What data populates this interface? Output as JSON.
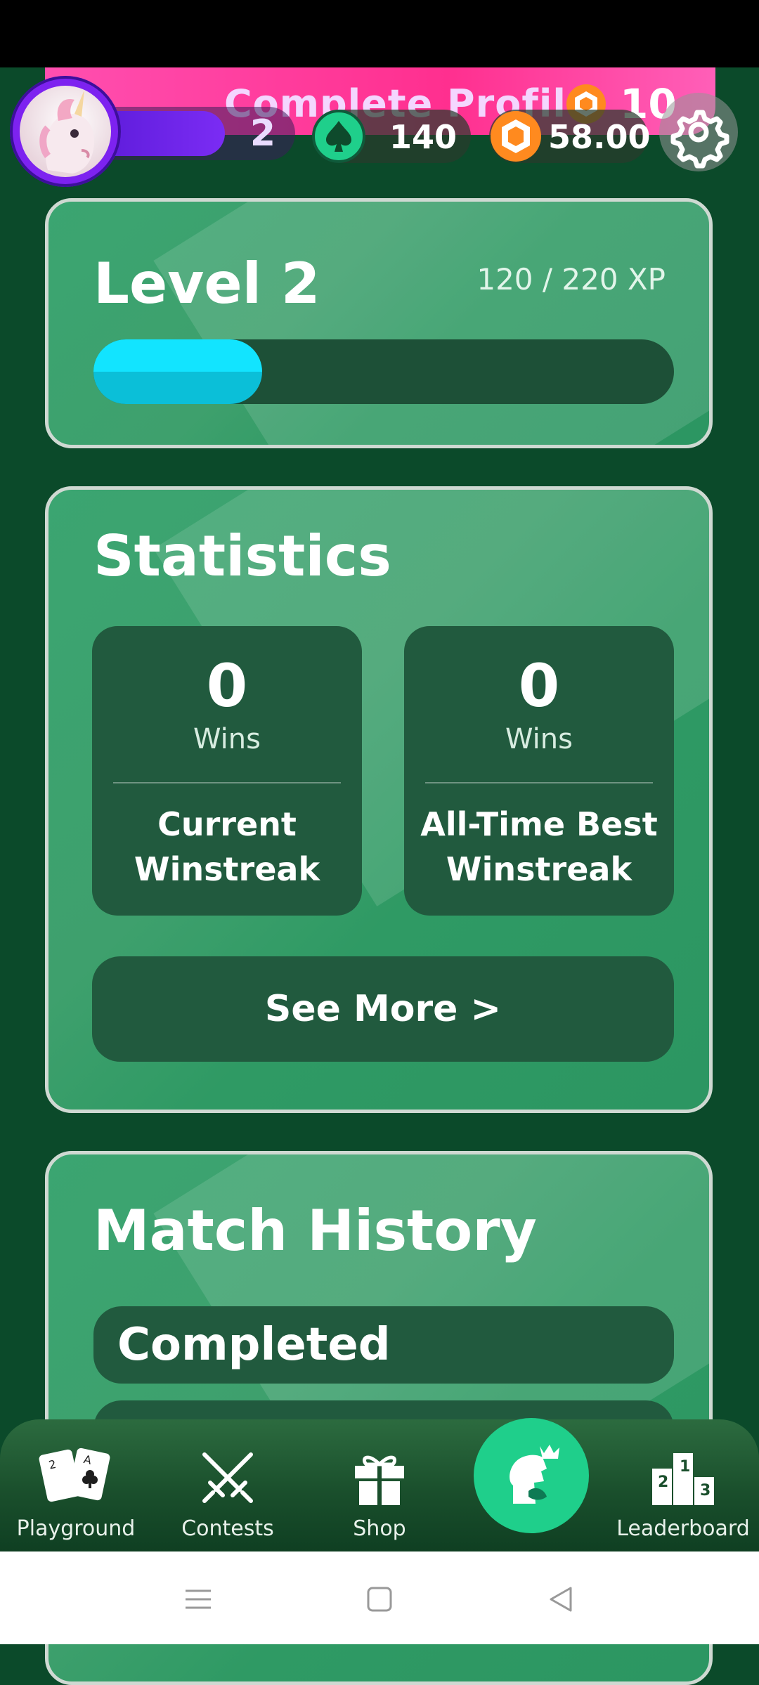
{
  "header": {
    "promo_text": "Complete Profile",
    "promo_reward": "10",
    "level_badge": "2",
    "spade_balance": "140",
    "coin_balance": "58.00"
  },
  "level_card": {
    "title": "Level 2",
    "xp_text": "120 / 220 XP",
    "xp_progress_fraction": 0.2
  },
  "statistics": {
    "title": "Statistics",
    "current": {
      "value": "0",
      "unit": "Wins",
      "label_line1": "Current",
      "label_line2": "Winstreak"
    },
    "best": {
      "value": "0",
      "unit": "Wins",
      "label_line1": "All-Time Best",
      "label_line2": "Winstreak"
    },
    "see_more": "See More >"
  },
  "match_history": {
    "title": "Match History",
    "rows": [
      "Completed"
    ]
  },
  "nav": {
    "playground": "Playground",
    "contests": "Contests",
    "shop": "Shop",
    "leaderboard": "Leaderboard"
  },
  "colors": {
    "background": "#0b4a2a",
    "card": "#3ba571",
    "dark_panel": "#215a3e",
    "xp_fill": "#12e4ff",
    "promo": "#ff2f8f",
    "accent_green": "#1fcf8b",
    "coin_orange": "#ff8a1f"
  },
  "icons": {
    "settings": "gear-icon",
    "spade": "spade-icon",
    "coin": "coin-icon",
    "playground": "cards-icon",
    "contests": "crossed-swords-icon",
    "shop": "gift-icon",
    "play": "knight-crown-icon",
    "leaderboard": "podium-icon"
  }
}
